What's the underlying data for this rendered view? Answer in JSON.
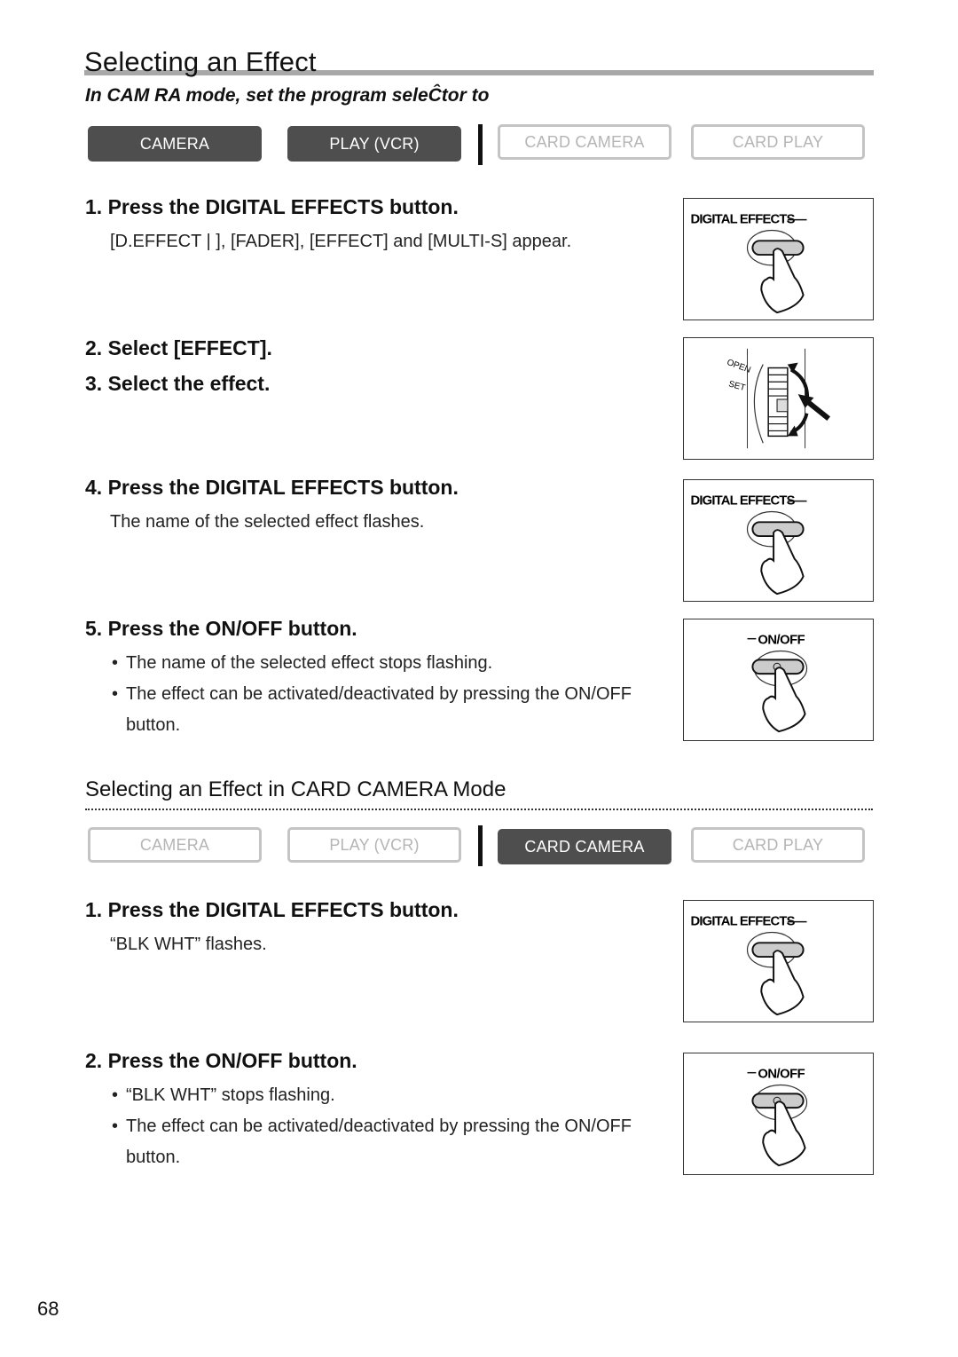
{
  "page": {
    "title": "Selecting an Effect",
    "subtitle": "In CAM  RA mode, set the program seleĈtor to",
    "page_number": "68"
  },
  "mode_bar_top": {
    "buttons": [
      {
        "label": "CAMERA",
        "active": true
      },
      {
        "label": "PLAY (VCR)",
        "active": true
      },
      {
        "label": "CARD CAMERA",
        "active": false
      },
      {
        "label": "CARD PLAY",
        "active": false
      }
    ]
  },
  "steps_camera": [
    {
      "heading": "1. Press the DIGITAL EFFECTS button.",
      "description": "[D.EFFECT |    ], [FADER], [EFFECT] and [MULTI-S] appear.",
      "figure": "digital-effects-button"
    },
    {
      "heading": "2. Select [EFFECT].",
      "figure": "selector-dial"
    },
    {
      "heading": "3. Select the effect."
    },
    {
      "heading": "4. Press the DIGITAL EFFECTS button.",
      "description": "The name of the selected effect flashes.",
      "figure": "digital-effects-button"
    },
    {
      "heading": "5. Press the ON/OFF button.",
      "bullets": [
        "The name of the selected effect stops flashing.",
        "The effect can be activated/deactivated by pressing the ON/OFF",
        "button."
      ],
      "figure": "on-off-button"
    }
  ],
  "section_card": {
    "title": "Selecting an Effect in CARD CAMERA Mode"
  },
  "mode_bar_bottom": {
    "buttons": [
      {
        "label": "CAMERA",
        "active": false
      },
      {
        "label": "PLAY (VCR)",
        "active": false
      },
      {
        "label": "CARD CAMERA",
        "active": true
      },
      {
        "label": "CARD PLAY",
        "active": false
      }
    ]
  },
  "steps_card": [
    {
      "heading": "1. Press the DIGITAL EFFECTS button.",
      "description": "“BLK   WHT” flashes.",
      "figure": "digital-effects-button"
    },
    {
      "heading": "2. Press the ON/OFF button.",
      "bullets": [
        "“BLK   WHT” stops flashing.",
        "The effect can be activated/deactivated by pressing the ON/OFF",
        "button."
      ],
      "figure": "on-off-button"
    }
  ],
  "figures": {
    "digital_effects_label": "DIGITAL EFFECTS",
    "on_off_label": "ON/OFF",
    "dial_labels": [
      "OPEN",
      "SET"
    ]
  },
  "bullet_glyph": "•"
}
